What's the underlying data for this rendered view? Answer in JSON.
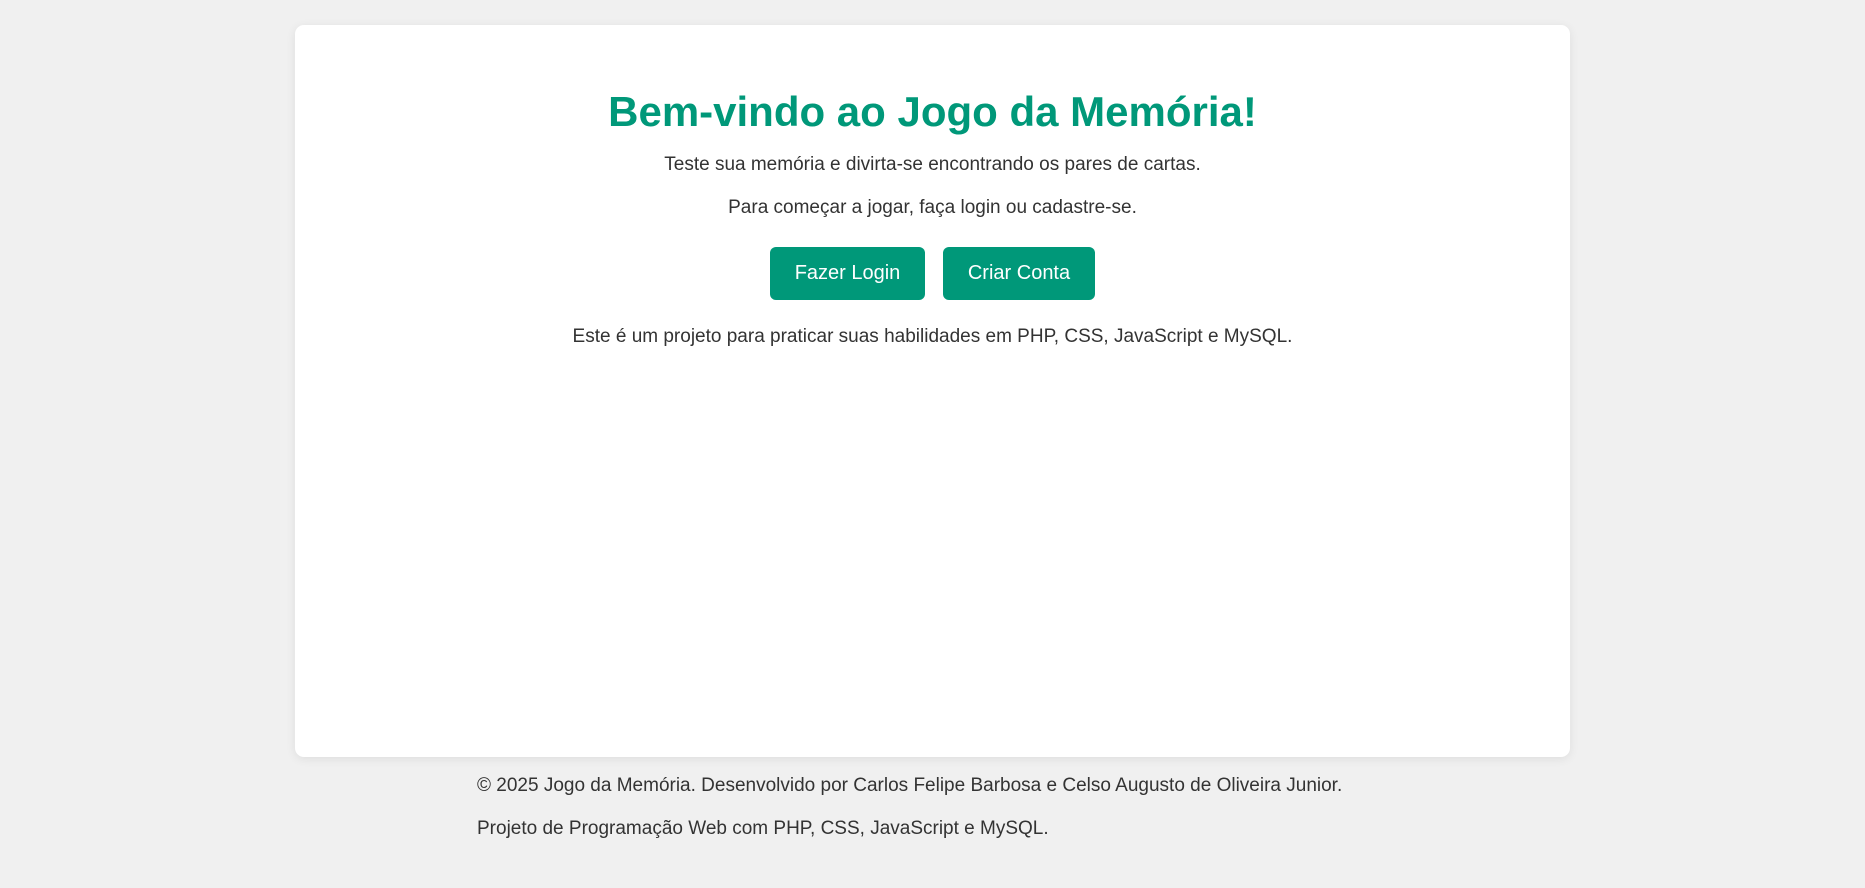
{
  "colors": {
    "accent": "#009879",
    "background": "#f0f0f0",
    "card": "#ffffff",
    "text": "#333333"
  },
  "main": {
    "title": "Bem-vindo ao Jogo da Memória!",
    "subtitle": "Teste sua memória e divirta-se encontrando os pares de cartas.",
    "prompt": "Para começar a jogar, faça login ou cadastre-se.",
    "buttons": {
      "login": "Fazer Login",
      "register": "Criar Conta"
    },
    "info": "Este é um projeto para praticar suas habilidades em PHP, CSS, JavaScript e MySQL."
  },
  "footer": {
    "copyright": "© 2025 Jogo da Memória. Desenvolvido por Carlos Felipe Barbosa e Celso Augusto de Oliveira Junior.",
    "project": "Projeto de Programação Web com PHP, CSS, JavaScript e MySQL."
  }
}
